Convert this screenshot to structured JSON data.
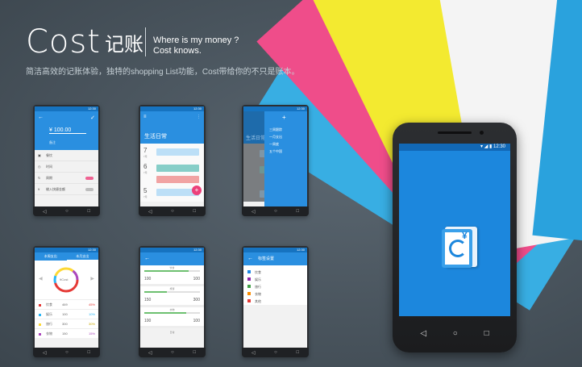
{
  "header": {
    "brand": "Cost",
    "brand_cn": "记账",
    "tagline_1": "Where is my money ?",
    "tagline_2": "Cost knows.",
    "subtitle": "简洁高效的记账体验，独特的shopping List功能，Cost带给你的不只是账本。"
  },
  "colors": {
    "background": "#4b565f",
    "app_blue": "#2a8fe0",
    "fan": [
      "#3db3e6",
      "#f04e8c",
      "#f5ec32",
      "#ffffff"
    ]
  },
  "phone1": {
    "time": "12:30",
    "amount": "¥  100.00",
    "hint": "备注",
    "rows": [
      "餐饮",
      "时间",
      "周期",
      "输入快捷金额"
    ]
  },
  "phone2": {
    "time": "12:30",
    "title": "生活日常",
    "days": [
      {
        "num": "7",
        "mon": "7月"
      },
      {
        "num": "6",
        "mon": "7月"
      },
      {
        "num": "5",
        "mon": "7月"
      }
    ],
    "fab": "+"
  },
  "phone3": {
    "time": "12:30",
    "title": "生活日常",
    "menu": [
      "三周跟踪",
      "一月支出",
      "一周度",
      "五个中国"
    ]
  },
  "phone4": {
    "time": "12:30",
    "tabs": [
      "本周支出",
      "本月支出"
    ],
    "center": "¥Cost",
    "legend": [
      {
        "name": "饮食",
        "value": "469",
        "pct": "45%",
        "color": "#e53935"
      },
      {
        "name": "娱乐",
        "value": "100",
        "pct": "10%",
        "color": "#29b6f6"
      },
      {
        "name": "旅行",
        "value": "300",
        "pct": "30%",
        "color": "#fdd835"
      },
      {
        "name": "衣物",
        "value": "150",
        "pct": "15%",
        "color": "#ab47bc"
      }
    ]
  },
  "phone5": {
    "time": "12:30",
    "groups": [
      {
        "label": "饮食",
        "left": "100",
        "right": "100",
        "fill": 0.8
      },
      {
        "label": "旅游",
        "left": "150",
        "right": "300",
        "fill": 0.4
      },
      {
        "label": "衣物",
        "left": "100",
        "right": "100",
        "fill": 0.75
      }
    ],
    "footer": "日常"
  },
  "phone6": {
    "time": "12:30",
    "title": "标签设置",
    "tags": [
      {
        "name": "饮食",
        "color": "#1e88e5"
      },
      {
        "name": "娱乐",
        "color": "#8e24aa"
      },
      {
        "name": "旅行",
        "color": "#43a047"
      },
      {
        "name": "衣物",
        "color": "#fb8c00"
      },
      {
        "name": "其他",
        "color": "#e53935"
      }
    ]
  },
  "big_phone": {
    "time": "12:30",
    "logo_symbol": "¥"
  }
}
